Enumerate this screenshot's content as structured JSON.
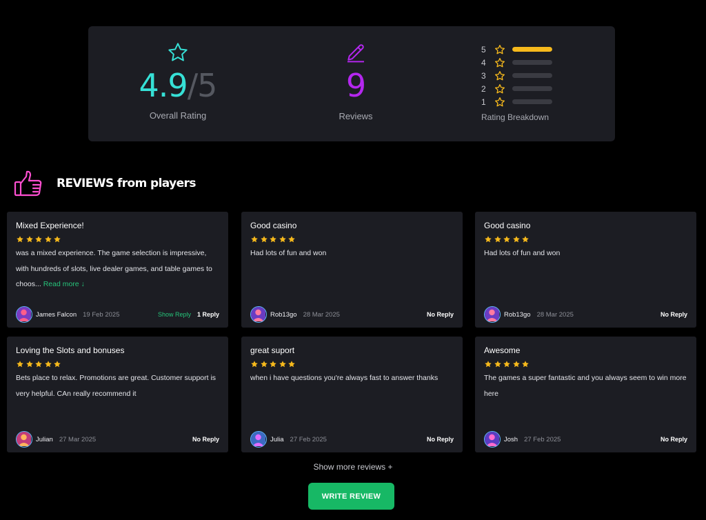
{
  "summary": {
    "overall_score": "4.9",
    "overall_separator": "/5",
    "overall_label": "Overall Rating",
    "reviews_count": "9",
    "reviews_label": "Reviews",
    "breakdown_label": "Rating Breakdown",
    "breakdown": [
      {
        "stars": "5",
        "fraction": 1.0
      },
      {
        "stars": "4",
        "fraction": 0
      },
      {
        "stars": "3",
        "fraction": 0
      },
      {
        "stars": "2",
        "fraction": 0
      },
      {
        "stars": "1",
        "fraction": 0
      }
    ]
  },
  "section": {
    "title": "REVIEWS from players",
    "icon": "thumbs-up-icon"
  },
  "reviews": [
    {
      "title": "Mixed Experience!",
      "rating": 5,
      "body": "was a mixed experience. The game selection is impressive, with hundreds of slots, live dealer games, and table games to choos...",
      "read_more": "Read more ↓",
      "author": "James Falcon",
      "date": "19 Feb 2025",
      "show_reply": "Show Reply",
      "reply_status": "1 Reply"
    },
    {
      "title": "Good casino",
      "rating": 5,
      "body": "Had lots of fun and won",
      "author": "Rob13go",
      "date": "28 Mar 2025",
      "reply_status": "No Reply"
    },
    {
      "title": "Good casino",
      "rating": 5,
      "body": "Had lots of fun and won",
      "author": "Rob13go",
      "date": "28 Mar 2025",
      "reply_status": "No Reply"
    },
    {
      "title": "Loving the Slots and bonuses",
      "rating": 5,
      "body": "Bets place to relax. Promotions are great. Customer support is very helpful. CAn really recommend it",
      "author": "Julian",
      "date": "27 Mar 2025",
      "reply_status": "No Reply"
    },
    {
      "title": "great suport",
      "rating": 5,
      "body": "when i have questions you're always fast to answer thanks",
      "author": "Julia",
      "date": "27 Feb 2025",
      "reply_status": "No Reply"
    },
    {
      "title": "Awesome",
      "rating": 5,
      "body": "The games a super fantastic and you always seem to win more here",
      "author": "Josh",
      "date": "27 Feb 2025",
      "reply_status": "No Reply"
    }
  ],
  "show_more": "Show more reviews +",
  "write_review": "WRITE REVIEW",
  "colors": {
    "accent_green": "#17b865",
    "teal": "#36e0d6",
    "purple": "#b427ef",
    "star": "#f6b91c",
    "panel": "#1c1d23"
  }
}
